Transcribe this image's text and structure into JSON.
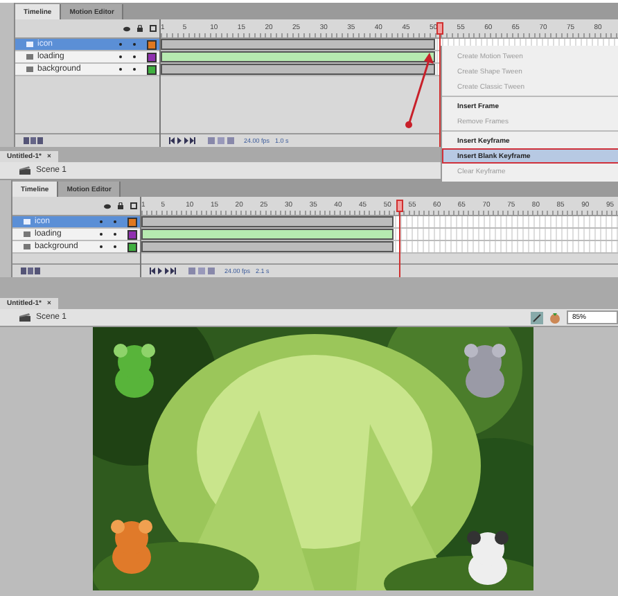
{
  "panels": [
    {
      "tabs": [
        {
          "label": "Timeline",
          "selected": true
        },
        {
          "label": "Motion Editor",
          "selected": false
        }
      ],
      "frame_labels": [
        "1",
        "5",
        "10",
        "15",
        "20",
        "25",
        "30",
        "35",
        "40",
        "45",
        "50",
        "55",
        "60",
        "65",
        "70",
        "75",
        "80"
      ],
      "layers": [
        {
          "name": "icon",
          "selected": true,
          "color": "#e07820",
          "kind": "static",
          "level": 0.6
        },
        {
          "name": "loading",
          "selected": false,
          "color": "#9030b0",
          "kind": "tween",
          "level": 0.6
        },
        {
          "name": "background",
          "selected": false,
          "color": "#40b040",
          "kind": "static",
          "level": 0.6
        }
      ],
      "fps": "24.00 fps",
      "time": "1.0 s",
      "document_tab": "Untitled-1*",
      "close": "×",
      "scene": "Scene 1"
    },
    {
      "tabs": [
        {
          "label": "Timeline",
          "selected": true
        },
        {
          "label": "Motion Editor",
          "selected": false
        }
      ],
      "frame_labels": [
        "1",
        "5",
        "10",
        "15",
        "20",
        "25",
        "30",
        "35",
        "40",
        "45",
        "50",
        "55",
        "60",
        "65",
        "70",
        "75",
        "80",
        "85",
        "90",
        "95"
      ],
      "layers": [
        {
          "name": "icon",
          "selected": true,
          "color": "#e07820",
          "kind": "static",
          "level": 0.53
        },
        {
          "name": "loading",
          "selected": false,
          "color": "#9030b0",
          "kind": "tween",
          "level": 0.53
        },
        {
          "name": "background",
          "selected": false,
          "color": "#40b040",
          "kind": "static",
          "level": 0.53
        }
      ],
      "fps": "24.00 fps",
      "time": "2.1 s",
      "document_tab": "Untitled-1*",
      "close": "×",
      "scene": "Scene 1"
    }
  ],
  "context_menu": [
    {
      "kind": "item",
      "label": "Create Motion Tween",
      "disabled": true,
      "selected": false
    },
    {
      "kind": "item",
      "label": "Create Shape Tween",
      "disabled": true,
      "selected": false
    },
    {
      "kind": "item",
      "label": "Create Classic Tween",
      "disabled": true,
      "selected": false
    },
    {
      "kind": "separator"
    },
    {
      "kind": "item",
      "label": "Insert Frame",
      "disabled": false,
      "selected": false
    },
    {
      "kind": "item",
      "label": "Remove Frames",
      "disabled": true,
      "selected": false
    },
    {
      "kind": "separator"
    },
    {
      "kind": "item",
      "label": "Insert Keyframe",
      "disabled": false,
      "selected": false
    },
    {
      "kind": "item",
      "label": "Insert Blank Keyframe",
      "disabled": false,
      "selected": true
    },
    {
      "kind": "item",
      "label": "Clear Keyframe",
      "disabled": true,
      "selected": false
    }
  ],
  "stage": {
    "zoom": "85%"
  }
}
